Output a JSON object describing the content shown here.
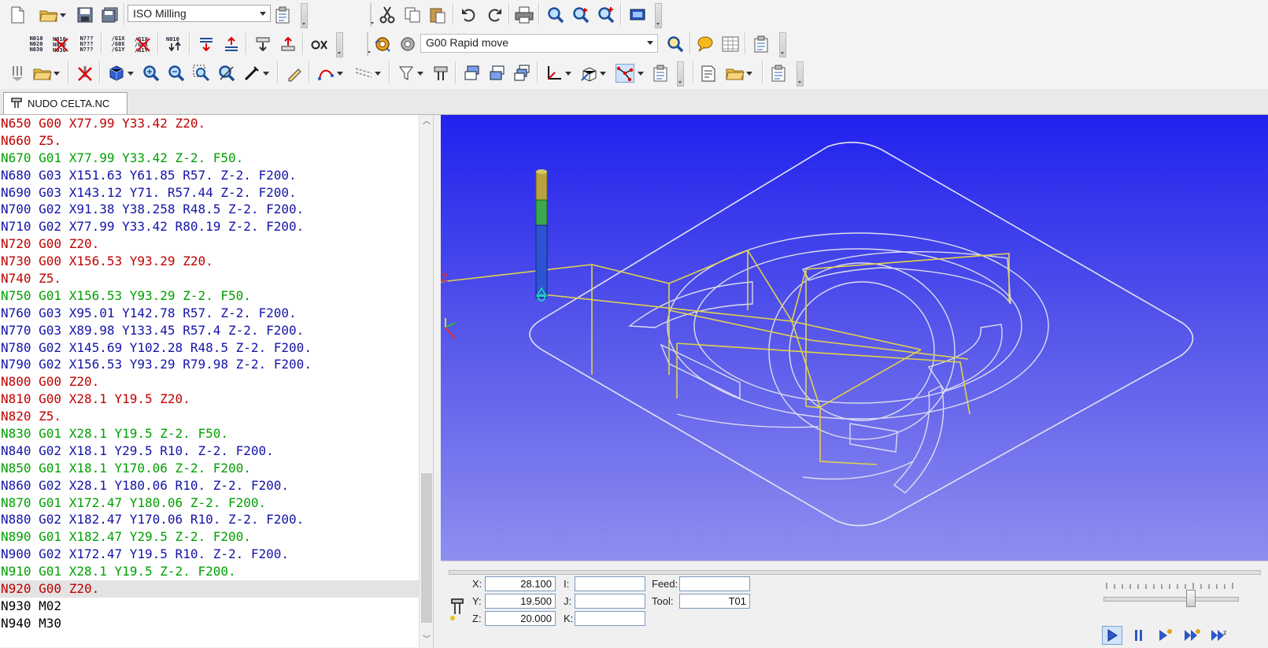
{
  "toolbar": {
    "machine_combo": "ISO Milling",
    "move_combo": "G00 Rapid move"
  },
  "tabs": [
    {
      "label": "NUDO CELTA.NC"
    }
  ],
  "code": [
    {
      "text": "N650 G00 X77.99 Y33.42 Z20.",
      "color": "red"
    },
    {
      "text": "N660 Z5.",
      "color": "red"
    },
    {
      "text": "N670 G01 X77.99 Y33.42 Z-2. F50.",
      "color": "green"
    },
    {
      "text": "N680 G03 X151.63 Y61.85 R57. Z-2. F200.",
      "color": "blue"
    },
    {
      "text": "N690 G03 X143.12 Y71. R57.44 Z-2. F200.",
      "color": "blue"
    },
    {
      "text": "N700 G02 X91.38 Y38.258 R48.5 Z-2. F200.",
      "color": "blue"
    },
    {
      "text": "N710 G02 X77.99 Y33.42 R80.19 Z-2. F200.",
      "color": "blue"
    },
    {
      "text": "N720 G00 Z20.",
      "color": "red"
    },
    {
      "text": "N730 G00 X156.53 Y93.29 Z20.",
      "color": "red"
    },
    {
      "text": "N740 Z5.",
      "color": "red"
    },
    {
      "text": "N750 G01 X156.53 Y93.29 Z-2. F50.",
      "color": "green"
    },
    {
      "text": "N760 G03 X95.01 Y142.78 R57. Z-2. F200.",
      "color": "blue"
    },
    {
      "text": "N770 G03 X89.98 Y133.45 R57.4 Z-2. F200.",
      "color": "blue"
    },
    {
      "text": "N780 G02 X145.69 Y102.28 R48.5 Z-2. F200.",
      "color": "blue"
    },
    {
      "text": "N790 G02 X156.53 Y93.29 R79.98 Z-2. F200.",
      "color": "blue"
    },
    {
      "text": "N800 G00 Z20.",
      "color": "red"
    },
    {
      "text": "N810 G00 X28.1 Y19.5 Z20.",
      "color": "red"
    },
    {
      "text": "N820 Z5.",
      "color": "red"
    },
    {
      "text": "N830 G01 X28.1 Y19.5 Z-2. F50.",
      "color": "green"
    },
    {
      "text": "N840 G02 X18.1 Y29.5 R10. Z-2. F200.",
      "color": "blue"
    },
    {
      "text": "N850 G01 X18.1 Y170.06 Z-2. F200.",
      "color": "green"
    },
    {
      "text": "N860 G02 X28.1 Y180.06 R10. Z-2. F200.",
      "color": "blue"
    },
    {
      "text": "N870 G01 X172.47 Y180.06 Z-2. F200.",
      "color": "green"
    },
    {
      "text": "N880 G02 X182.47 Y170.06 R10. Z-2. F200.",
      "color": "blue"
    },
    {
      "text": "N890 G01 X182.47 Y29.5 Z-2. F200.",
      "color": "green"
    },
    {
      "text": "N900 G02 X172.47 Y19.5 R10. Z-2. F200.",
      "color": "blue"
    },
    {
      "text": "N910 G01 X28.1 Y19.5 Z-2. F200.",
      "color": "green"
    },
    {
      "text": "N920 G00 Z20.",
      "color": "red",
      "highlight": true
    },
    {
      "text": "N930 M02",
      "color": "black"
    },
    {
      "text": "N940 M30",
      "color": "black"
    }
  ],
  "viewport": {
    "axis_label": "Z"
  },
  "coords": {
    "x_label": "X:",
    "x": "28.100",
    "y_label": "Y:",
    "y": "19.500",
    "z_label": "Z:",
    "z": "20.000",
    "i_label": "I:",
    "i": "",
    "j_label": "J:",
    "j": "",
    "k_label": "K:",
    "k": "",
    "feed_label": "Feed:",
    "feed": "",
    "tool_label": "Tool:",
    "tool": "T01"
  }
}
